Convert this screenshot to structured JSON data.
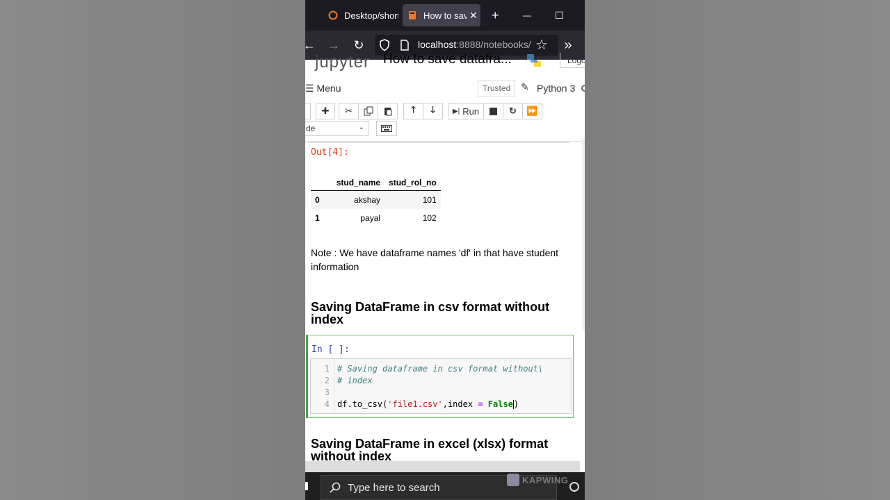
{
  "browser": {
    "tabs": [
      {
        "label": "Desktop/short"
      },
      {
        "label": "How to save"
      }
    ],
    "new_tab": "+",
    "tab_close": "✕",
    "window_controls": {
      "minimize": "—",
      "maximize": "☐"
    },
    "url_host": "localhost",
    "url_rest": ":8888/notebooks/",
    "nav": {
      "back": "←",
      "forward": "→",
      "reload": "↻",
      "star": "☆",
      "overflow": "»"
    }
  },
  "jupyter": {
    "logo_text": "jupyter",
    "notebook_title": "How to save datafra...",
    "logout": "Logo",
    "menu": "Menu",
    "menu_icon": "☰",
    "trusted": "Trusted",
    "kernel": "Python 3",
    "toolbar": {
      "run_label": "Run",
      "cell_type": "de"
    }
  },
  "notebook": {
    "out_prompt": "Out[4]:",
    "table": {
      "columns": [
        "",
        "stud_name",
        "stud_rol_no"
      ],
      "rows": [
        [
          "0",
          "akshay",
          "101"
        ],
        [
          "1",
          "payal",
          "102"
        ]
      ]
    },
    "note": "Note : We have dataframe names 'df' in that have student information",
    "heading1": "Saving DataFrame in csv format without index",
    "in_prompt": "In [ ]:",
    "code_lines": [
      {
        "n": "1",
        "comment": "# Saving dataframe in csv format without\\"
      },
      {
        "n": "2",
        "comment": "# index"
      },
      {
        "n": "3"
      },
      {
        "n": "4",
        "p1": "df.to_csv(",
        "str": "'file1.csv'",
        "p2": ",index ",
        "op": "=",
        "p3": " ",
        "kw": "False",
        "p4": ")"
      }
    ],
    "heading2": "Saving DataFrame in excel (xlsx) format without index"
  },
  "taskbar": {
    "search_placeholder": "Type here to search",
    "watermark": "KAPWING"
  },
  "colors": {
    "tabbar": "#1c1b22",
    "navbar": "#2b2a33",
    "out_prompt": "#d84315",
    "in_prompt": "#303f9f",
    "cell_selected": "#42a547"
  }
}
